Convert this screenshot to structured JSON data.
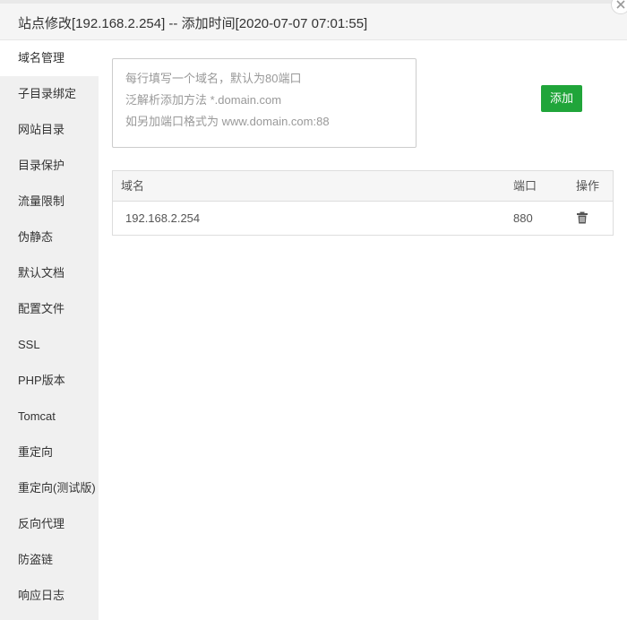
{
  "window": {
    "title": "站点修改[192.168.2.254] -- 添加时间[2020-07-07 07:01:55]",
    "close_icon": "close-icon"
  },
  "sidebar": {
    "active_index": 0,
    "items": [
      {
        "label": "域名管理"
      },
      {
        "label": "子目录绑定"
      },
      {
        "label": "网站目录"
      },
      {
        "label": "目录保护"
      },
      {
        "label": "流量限制"
      },
      {
        "label": "伪静态"
      },
      {
        "label": "默认文档"
      },
      {
        "label": "配置文件"
      },
      {
        "label": "SSL"
      },
      {
        "label": "PHP版本"
      },
      {
        "label": "Tomcat"
      },
      {
        "label": "重定向"
      },
      {
        "label": "重定向(测试版)"
      },
      {
        "label": "反向代理"
      },
      {
        "label": "防盗链"
      },
      {
        "label": "响应日志"
      }
    ]
  },
  "domain_form": {
    "value": "",
    "placeholder_lines": [
      "每行填写一个域名，默认为80端口",
      "泛解析添加方法 *.domain.com",
      "如另加端口格式为 www.domain.com:88"
    ],
    "add_label": "添加"
  },
  "domain_table": {
    "columns": {
      "domain": "域名",
      "port": "端口",
      "action": "操作"
    },
    "rows": [
      {
        "domain": "192.168.2.254",
        "port": "880",
        "action_icon": "trash-icon"
      }
    ]
  },
  "colors": {
    "accent": "#20a53a",
    "sidebar_bg": "#f0f0f0",
    "titlebar_bg": "#f5f5f5"
  }
}
